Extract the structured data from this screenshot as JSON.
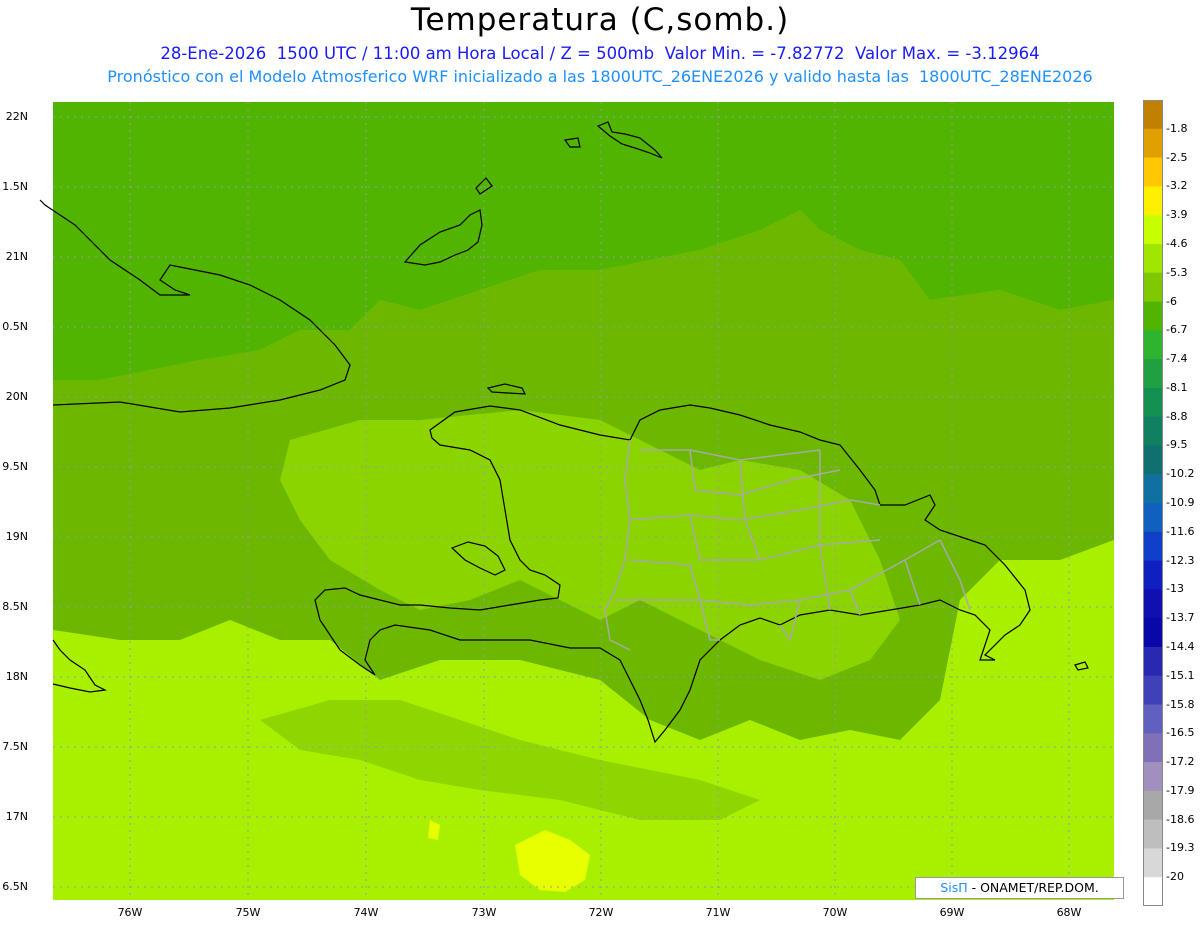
{
  "header": {
    "title": "Temperatura (C,somb.)",
    "subtitle": "28-Ene-2026  1500 UTC / 11:00 am Hora Local / Z = 500mb  Valor Min. = -7.82772  Valor Max. = -3.12964",
    "model_line": "Pronóstico con el Modelo Atmosferico WRF inicializado a las 1800UTC_26ENE2026 y valido hasta las  1800UTC_28ENE2026"
  },
  "axes": {
    "lat_labels": [
      "22N",
      "1.5N",
      "21N",
      "0.5N",
      "20N",
      "9.5N",
      "19N",
      "8.5N",
      "18N",
      "7.5N",
      "17N",
      "6.5N"
    ],
    "lon_labels": [
      "76W",
      "75W",
      "74W",
      "73W",
      "72W",
      "71W",
      "70W",
      "69W",
      "68W"
    ]
  },
  "colorbar": {
    "labels": [
      "-1.8",
      "-2.5",
      "-3.2",
      "-3.9",
      "-4.6",
      "-5.3",
      "-6",
      "-6.7",
      "-7.4",
      "-8.1",
      "-8.8",
      "-9.5",
      "-10.2",
      "-10.9",
      "-11.6",
      "-12.3",
      "-13",
      "-13.7",
      "-14.4",
      "-15.1",
      "-15.8",
      "-16.5",
      "-17.2",
      "-17.9",
      "-18.6",
      "-19.3",
      "-20"
    ],
    "colors": [
      "#c08000",
      "#e0a000",
      "#ffc800",
      "#fff000",
      "#c8ff00",
      "#a0e600",
      "#80c800",
      "#50b400",
      "#30b430",
      "#20a040",
      "#149050",
      "#108060",
      "#107070",
      "#1070a0",
      "#1060c0",
      "#1040c8",
      "#1020c0",
      "#1010b0",
      "#0808a8",
      "#2828b0",
      "#4040b8",
      "#6060c0",
      "#8070b8",
      "#a090c0",
      "#a8a8a8",
      "#bebebe",
      "#d8d8d8",
      "#ffffff"
    ]
  },
  "credit": {
    "brand": "SisΠ",
    "text": " - ONAMET/REP.DOM."
  }
}
